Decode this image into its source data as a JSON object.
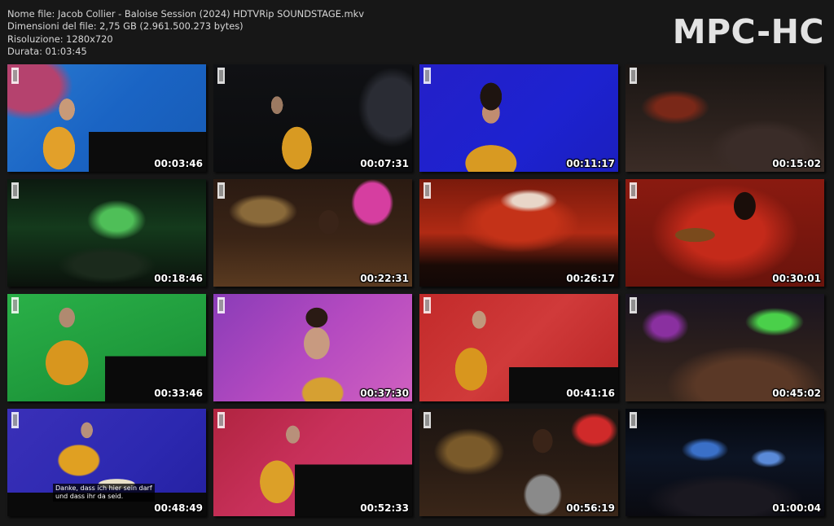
{
  "file_info": {
    "name_line": "Nome file: Jacob Collier - Baloise Session (2024) HDTVRip SOUNDSTAGE.mkv",
    "size_line": "Dimensioni del file: 2,75 GB (2.961.500.273 bytes)",
    "resolution_line": "Risoluzione: 1280x720",
    "duration_line": "Durata: 01:03:45"
  },
  "logo": {
    "text": "MPC-HC"
  },
  "thumbnails": [
    {
      "time": "00:03:46",
      "scene": "piano-blue-stage"
    },
    {
      "time": "00:07:31",
      "scene": "dark-stage-yellow-jacket"
    },
    {
      "time": "00:11:17",
      "scene": "singer-mic-blue"
    },
    {
      "time": "00:15:02",
      "scene": "crowd-stage-wide"
    },
    {
      "time": "00:18:46",
      "scene": "green-stage-wide"
    },
    {
      "time": "00:22:31",
      "scene": "drummer-baloise-sign"
    },
    {
      "time": "00:26:17",
      "scene": "red-stage-baloise-sign"
    },
    {
      "time": "00:30:01",
      "scene": "red-singer-cymbals"
    },
    {
      "time": "00:33:46",
      "scene": "piano-green-stage"
    },
    {
      "time": "00:37:30",
      "scene": "singer-closeup-purple"
    },
    {
      "time": "00:41:16",
      "scene": "piano-red-stage"
    },
    {
      "time": "00:45:02",
      "scene": "crowd-green-lights"
    },
    {
      "time": "00:48:49",
      "scene": "bass-purple-stage",
      "subtitle": [
        "Danke, dass ich hier sein darf",
        "und dass ihr da seid."
      ]
    },
    {
      "time": "00:52:33",
      "scene": "piano-red-pink"
    },
    {
      "time": "00:56:19",
      "scene": "drummer-red-sign"
    },
    {
      "time": "01:00:04",
      "scene": "dark-arena-blue-lights"
    }
  ],
  "colors": {
    "background": "#171717",
    "text": "#d6d6d6",
    "logo": "#e3e3e3",
    "timestamp": "#ffffff"
  }
}
